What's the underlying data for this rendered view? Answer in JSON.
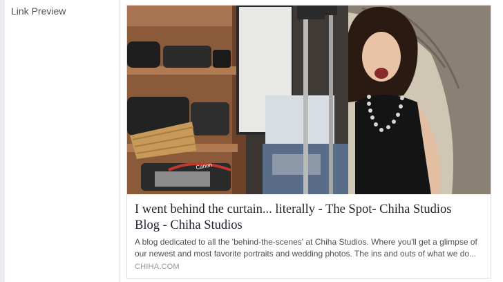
{
  "panel": {
    "section_label": "Link Preview"
  },
  "link_preview": {
    "title_line1": "I went behind the curtain... literally - The Spot- Chiha Studios",
    "title_line2": "Blog - Chiha Studios",
    "description_line1": "A blog dedicated to all the 'behind-the-scenes' at Chiha Studios. Where you'll get a glimpse of",
    "description_line2": "our newest and most favorite portraits and wedding photos. The ins and outs of what we do...",
    "domain": "CHIHA.COM",
    "image_strap_text": "Canon"
  },
  "colors": {
    "page_background": "#ffffff",
    "left_edge": "#e9ebee",
    "border": "#dddfe2",
    "title_text": "#1d2129",
    "body_text": "#4b4f56",
    "muted_text": "#90949c"
  }
}
